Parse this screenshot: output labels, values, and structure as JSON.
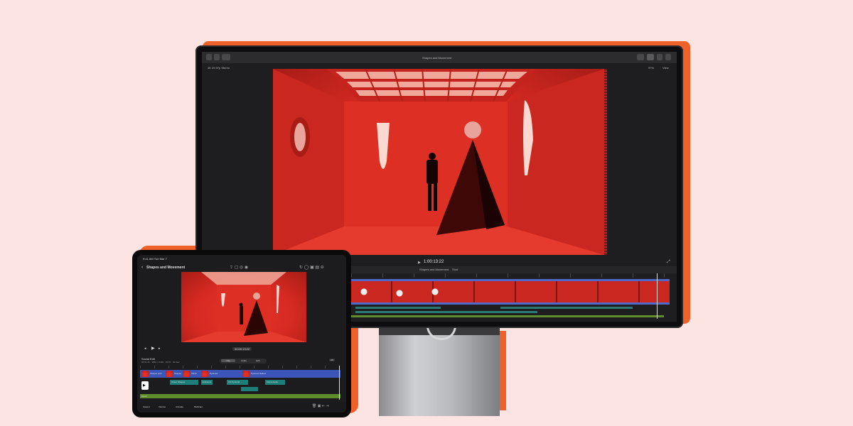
{
  "monitor": {
    "project_title": "Shapes and Movement",
    "timecode": "1:00:13:22",
    "top_left_label": "4K 29.97p Stereo",
    "view_menu": "View",
    "zoom": "97%",
    "timeline_title": "Shapes and Movement",
    "timeline_meta": "Shot"
  },
  "ipad": {
    "status_time": "9:41 AM Tue Mar 7",
    "project_title": "Shapes and Movement",
    "timecode": "00:00:13:22",
    "timeline_label": "Social Edit",
    "timeline_meta": "00:01:15 · 3840 × 2160 · 29.97 · 4K Sec",
    "segments": [
      "Clip",
      "Audio",
      "Edit"
    ],
    "zoom_chip": "HD",
    "bottom_tools": [
      "Inspect",
      "Volume",
      "Animate",
      "Multicam"
    ],
    "clips": [
      "Shapes pink",
      "Shapes",
      "Climb",
      "Pyramid",
      "Pyramid Reflect"
    ],
    "audio": [
      "Cheer Shapes",
      "Ambience",
      "VO Pyramid",
      "Climb Audio",
      "Music"
    ]
  },
  "colors": {
    "background": "#fbe4e2",
    "accent": "#f0612a",
    "scene_red": "#d62a22",
    "clip_blue": "#3b56b8",
    "audio_teal": "#1e7f7a",
    "music_green": "#5f8d2b"
  }
}
